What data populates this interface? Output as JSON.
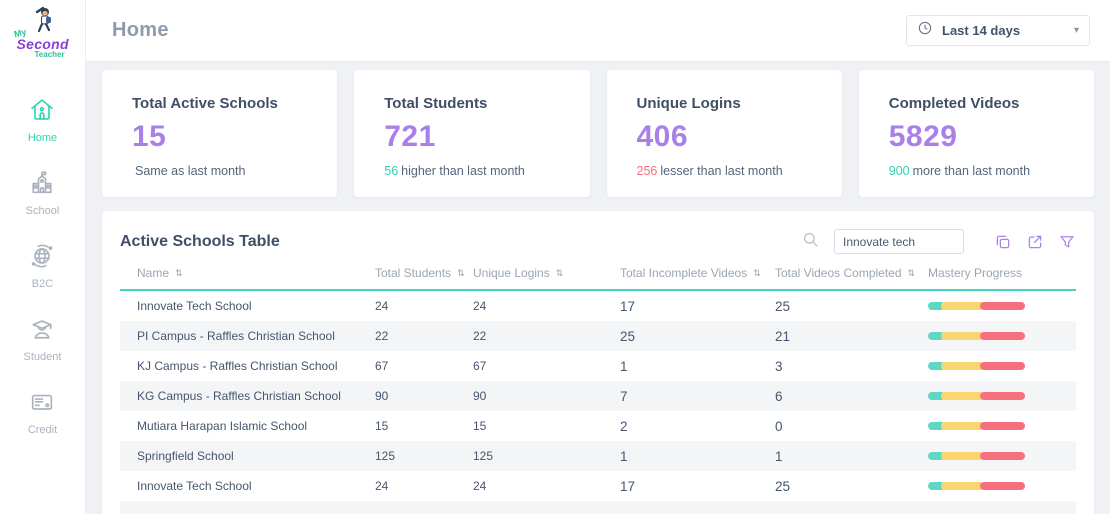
{
  "logo": {
    "word1": "My",
    "word2": "Second",
    "word3": "Teacher"
  },
  "sidebar": {
    "items": [
      {
        "label": "Home",
        "icon": "home-icon",
        "active": true
      },
      {
        "label": "School",
        "icon": "school-icon",
        "active": false
      },
      {
        "label": "B2C",
        "icon": "globe-icon",
        "active": false
      },
      {
        "label": "Student",
        "icon": "student-icon",
        "active": false
      },
      {
        "label": "Credit",
        "icon": "credit-card-icon",
        "active": false
      }
    ]
  },
  "header": {
    "title": "Home",
    "date_filter": {
      "value": "Last 14 days",
      "icon": "clock-icon"
    }
  },
  "stat_cards": [
    {
      "title": "Total Active Schools",
      "value": "15",
      "note_value": "",
      "note_text": "Same as last month",
      "note_color": ""
    },
    {
      "title": "Total Students",
      "value": "721",
      "note_value": "56",
      "note_text": "higher than last month",
      "note_color": "#2fd3b5"
    },
    {
      "title": "Unique Logins",
      "value": "406",
      "note_value": "256",
      "note_text": "lesser than last month",
      "note_color": "#f76e7e"
    },
    {
      "title": "Completed Videos",
      "value": "5829",
      "note_value": "900",
      "note_text": "more than last month",
      "note_color": "#2fd3b5"
    }
  ],
  "table": {
    "title": "Active Schools Table",
    "search": {
      "value": "Innovate tech",
      "icon": "search-icon"
    },
    "tools": [
      "copy-icon",
      "export-icon",
      "filter-icon"
    ],
    "columns": [
      {
        "label": "Name",
        "sortable": true
      },
      {
        "label": "Total Students",
        "sortable": true
      },
      {
        "label": "Unique Logins",
        "sortable": true
      },
      {
        "label": "Total Incomplete Videos",
        "sortable": true
      },
      {
        "label": "Total Videos Completed",
        "sortable": true
      },
      {
        "label": "Mastery Progress",
        "sortable": false
      }
    ],
    "rows": [
      {
        "name": "Innovate Tech School",
        "total_students": "24",
        "unique_logins": "24",
        "total_incomplete_videos": "17",
        "total_videos_completed": "25",
        "mastery": {
          "teal": 16,
          "yellow": 41,
          "red": 43
        }
      },
      {
        "name": "PI Campus - Raffles Christian School",
        "total_students": "22",
        "unique_logins": "22",
        "total_incomplete_videos": "25",
        "total_videos_completed": "21",
        "mastery": {
          "teal": 16,
          "yellow": 41,
          "red": 43
        }
      },
      {
        "name": "KJ Campus - Raffles Christian School",
        "total_students": "67",
        "unique_logins": "67",
        "total_incomplete_videos": "1",
        "total_videos_completed": "3",
        "mastery": {
          "teal": 16,
          "yellow": 41,
          "red": 43
        }
      },
      {
        "name": "KG Campus - Raffles Christian School",
        "total_students": "90",
        "unique_logins": "90",
        "total_incomplete_videos": "7",
        "total_videos_completed": "6",
        "mastery": {
          "teal": 16,
          "yellow": 41,
          "red": 43
        }
      },
      {
        "name": "Mutiara Harapan Islamic School",
        "total_students": "15",
        "unique_logins": "15",
        "total_incomplete_videos": "2",
        "total_videos_completed": "0",
        "mastery": {
          "teal": 16,
          "yellow": 41,
          "red": 43
        }
      },
      {
        "name": "Springfield School",
        "total_students": "125",
        "unique_logins": "125",
        "total_incomplete_videos": "1",
        "total_videos_completed": "1",
        "mastery": {
          "teal": 16,
          "yellow": 41,
          "red": 43
        }
      },
      {
        "name": "Innovate Tech School",
        "total_students": "24",
        "unique_logins": "24",
        "total_incomplete_videos": "17",
        "total_videos_completed": "25",
        "mastery": {
          "teal": 16,
          "yellow": 41,
          "red": 43
        }
      }
    ]
  },
  "colors": {
    "accent_teal": "#2fd3b5",
    "accent_purple": "#a97fe9",
    "negative_red": "#f76e7e",
    "progress_teal": "#5ed8c2",
    "progress_yellow": "#f9d66f",
    "progress_red": "#f7707f",
    "table_divider": "#3fd5c2"
  },
  "sort_glyph": "⇅",
  "caret_glyph": "▾"
}
